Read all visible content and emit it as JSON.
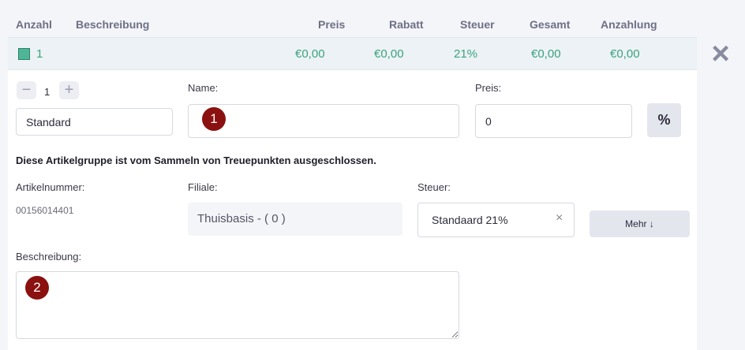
{
  "table": {
    "headers": [
      "Anzahl",
      "Beschreibung",
      "Preis",
      "Rabatt",
      "Steuer",
      "Gesamt",
      "Anzahlung"
    ],
    "row": {
      "quantity": "1",
      "preis": "€0,00",
      "rabatt": "€0,00",
      "steuer": "21%",
      "gesamt": "€0,00",
      "anzahlung": "€0,00"
    }
  },
  "close_icon": "×",
  "stepper": {
    "minus": "−",
    "value": "1",
    "plus": "+"
  },
  "variant": {
    "value": "Standard"
  },
  "name": {
    "label": "Name:",
    "value": ""
  },
  "preis": {
    "label": "Preis:",
    "value": "0"
  },
  "percent_button": "%",
  "loyalty_note": "Diese Artikelgruppe ist vom Sammeln von Treuepunkten ausgeschlossen.",
  "artikelnummer": {
    "label": "Artikelnummer:",
    "value": "00156014401"
  },
  "filiale": {
    "label": "Filiale:",
    "value": "Thuisbasis - ( 0 )"
  },
  "steuer": {
    "label": "Steuer:",
    "value": "Standaard 21%",
    "clear": "×"
  },
  "mehr_button": "Mehr",
  "mehr_arrow": "↓",
  "beschreibung": {
    "label": "Beschreibung:",
    "value": ""
  },
  "markers": [
    "1",
    "2"
  ]
}
